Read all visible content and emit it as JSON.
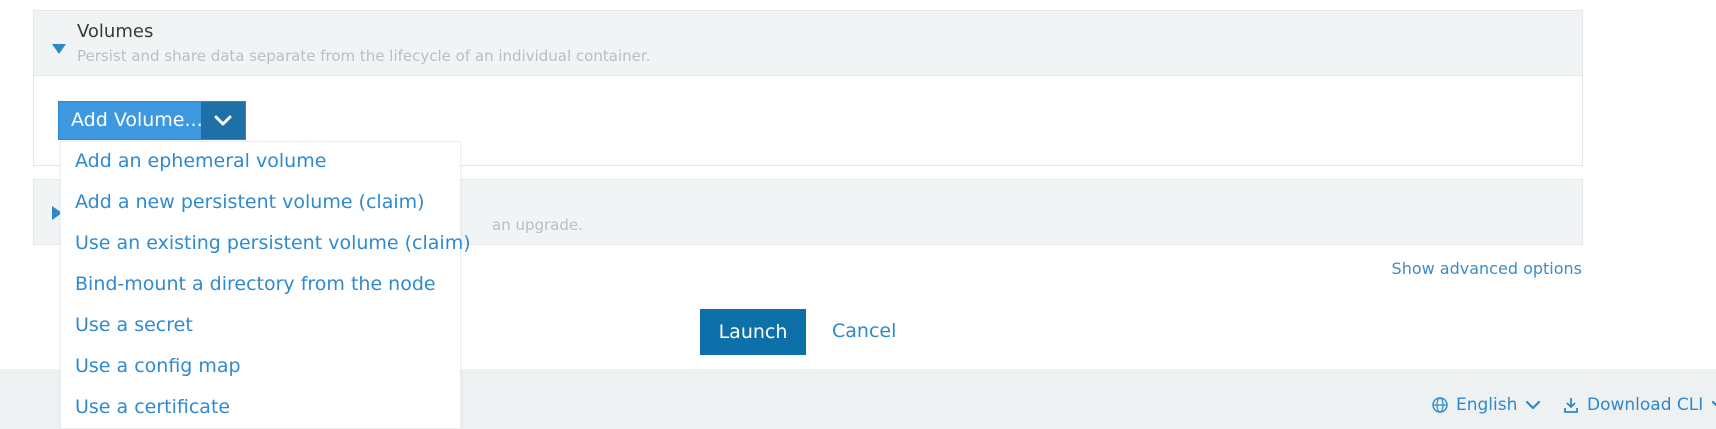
{
  "volumes_section": {
    "title": "Volumes",
    "subtitle": "Persist and share data separate from the lifecycle of an individual container."
  },
  "upgrade_section": {
    "subtitle_visible": "an upgrade."
  },
  "add_volume": {
    "label": "Add Volume...",
    "menu": [
      "Add an ephemeral volume",
      "Add a new persistent volume (claim)",
      "Use an existing persistent volume (claim)",
      "Bind-mount a directory from the node",
      "Use a secret",
      "Use a config map",
      "Use a certificate"
    ]
  },
  "advanced_link": "Show advanced options",
  "actions": {
    "launch": "Launch",
    "cancel": "Cancel"
  },
  "footer": {
    "language": "English",
    "download": "Download CLI"
  },
  "colors": {
    "accent": "#2e89c8",
    "primary_button": "#0e70a8",
    "footer_bg": "#eef1f2"
  }
}
